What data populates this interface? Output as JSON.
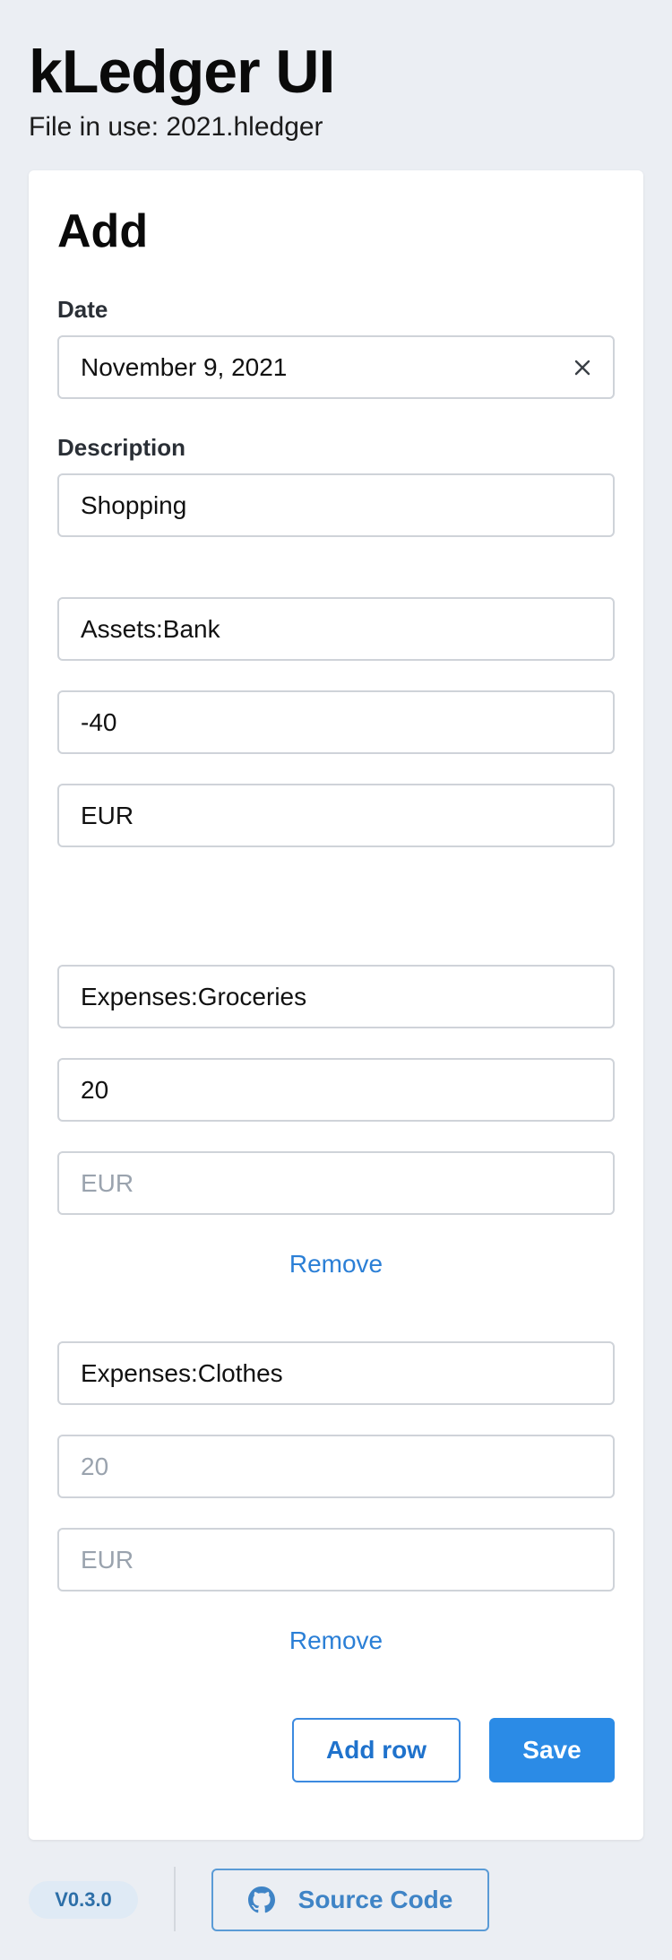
{
  "header": {
    "title": "kLedger UI",
    "file_in_use": "File in use: 2021.hledger"
  },
  "form": {
    "title": "Add",
    "date_label": "Date",
    "date_value": "November 9, 2021",
    "description_label": "Description",
    "description_value": "Shopping",
    "postings": [
      {
        "account": "Assets:Bank",
        "amount": "-40",
        "amount_placeholder": "",
        "commodity": "EUR",
        "commodity_placeholder": ""
      },
      {
        "account": "Expenses:Groceries",
        "amount": "20",
        "amount_placeholder": "",
        "commodity": "",
        "commodity_placeholder": "EUR",
        "remove_label": "Remove"
      },
      {
        "account": "Expenses:Clothes",
        "amount": "",
        "amount_placeholder": "20",
        "commodity": "",
        "commodity_placeholder": "EUR",
        "remove_label": "Remove"
      }
    ],
    "add_row_label": "Add row",
    "save_label": "Save"
  },
  "footer": {
    "version": "V0.3.0",
    "source_code_label": "Source Code"
  },
  "colors": {
    "accent": "#2b8be6",
    "link": "#2b7fd6",
    "background": "#ebeef3"
  },
  "icons": {
    "clear": "close-icon",
    "source": "github-icon"
  }
}
